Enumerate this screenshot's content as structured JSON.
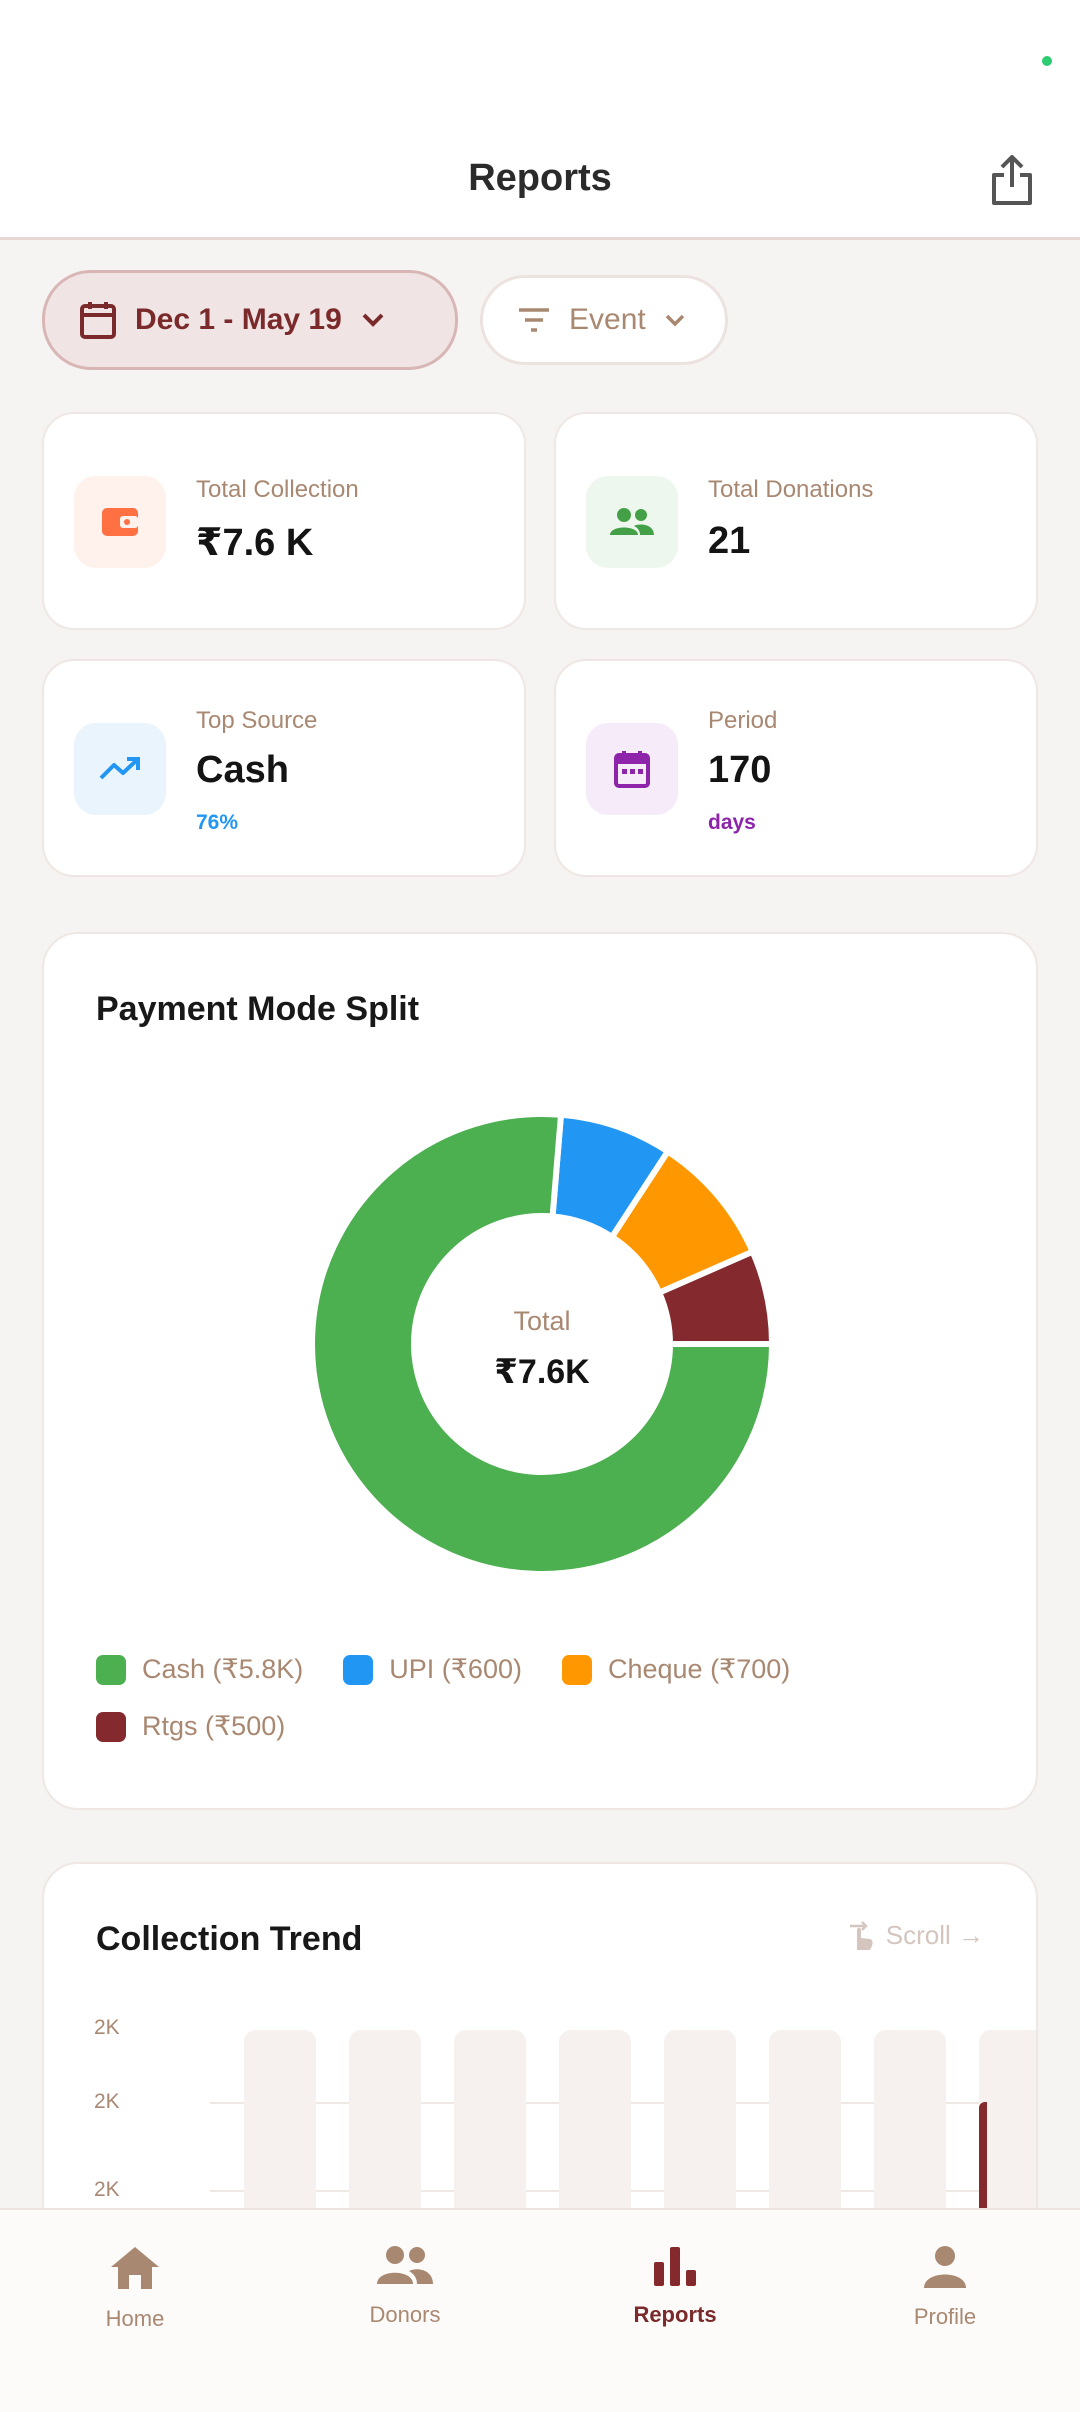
{
  "app_bar": {
    "title": "Reports",
    "share_icon": "share-icon"
  },
  "filters": {
    "date_range": {
      "label": "Dec 1 - May 19",
      "icon": "calendar-icon"
    },
    "event": {
      "label": "Event",
      "icon": "filter-icon"
    }
  },
  "stats": [
    {
      "label": "Total Collection",
      "value": "₹7.6 K",
      "icon": "wallet-icon",
      "accent": "#ff7043",
      "bg": "#fff1ec"
    },
    {
      "label": "Total Donations",
      "value": "21",
      "icon": "group-icon",
      "accent": "#43a047",
      "bg": "#edf7ee"
    },
    {
      "label": "Top Source",
      "value": "Cash",
      "sub": "76%",
      "icon": "trending-up-icon",
      "accent": "#2196f3",
      "bg": "#eaf4fd"
    },
    {
      "label": "Period",
      "value": "170",
      "sub": "days",
      "icon": "calendar-icon",
      "accent": "#8e24aa",
      "bg": "#f6ebf8"
    }
  ],
  "payment_split": {
    "title": "Payment Mode Split",
    "center_label": "Total",
    "center_value": "₹7.6K",
    "legend": [
      {
        "label": "Cash (₹5.8K)",
        "color": "#4caf50"
      },
      {
        "label": "UPI (₹600)",
        "color": "#2196f3"
      },
      {
        "label": "Cheque (₹700)",
        "color": "#ff9800"
      },
      {
        "label": "Rtgs (₹500)",
        "color": "#842a2e"
      }
    ]
  },
  "chart_data": {
    "type": "pie",
    "categories": [
      "Cash",
      "UPI",
      "Cheque",
      "Rtgs"
    ],
    "values": [
      5800,
      600,
      700,
      500
    ],
    "colors": [
      "#4caf50",
      "#2196f3",
      "#ff9800",
      "#842a2e"
    ],
    "title": "Payment Mode Split",
    "legend": "bottom"
  },
  "trend": {
    "title": "Collection Trend",
    "scroll_hint": "Scroll →",
    "y_ticks": [
      "2K",
      "2K",
      "2K"
    ]
  },
  "nav": [
    {
      "label": "Home",
      "icon": "home-icon",
      "active": false
    },
    {
      "label": "Donors",
      "icon": "people-icon",
      "active": false
    },
    {
      "label": "Reports",
      "icon": "bar-chart-icon",
      "active": true
    },
    {
      "label": "Profile",
      "icon": "person-icon",
      "active": false
    }
  ]
}
